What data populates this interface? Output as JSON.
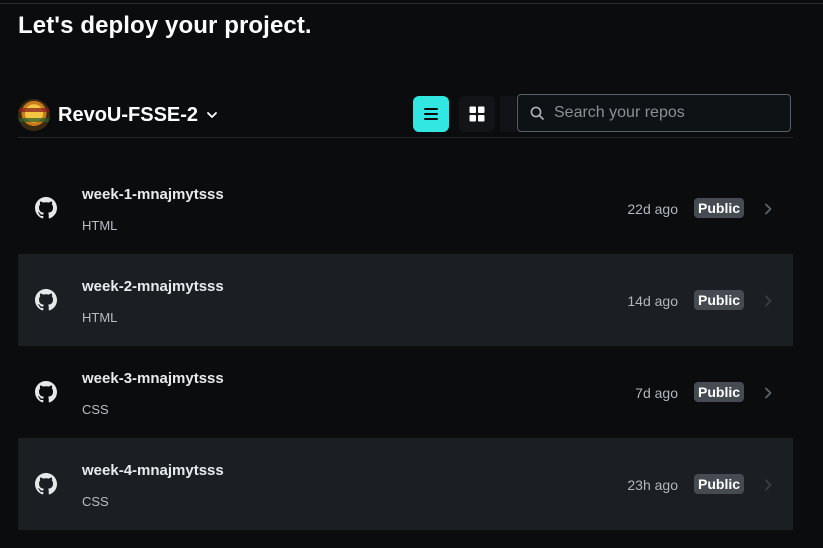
{
  "page": {
    "title": "Let's deploy your project."
  },
  "account": {
    "name": "RevoU-FSSE-2"
  },
  "view_toggle": {
    "selected": "list",
    "options": [
      "list",
      "grid"
    ]
  },
  "search": {
    "placeholder": "Search your repos",
    "value": ""
  },
  "repos": [
    {
      "name": "week-1-mnajmytsss",
      "language": "HTML",
      "updated": "22d ago",
      "visibility": "Public"
    },
    {
      "name": "week-2-mnajmytsss",
      "language": "HTML",
      "updated": "14d ago",
      "visibility": "Public"
    },
    {
      "name": "week-3-mnajmytsss",
      "language": "CSS",
      "updated": "7d ago",
      "visibility": "Public"
    },
    {
      "name": "week-4-mnajmytsss",
      "language": "CSS",
      "updated": "23h ago",
      "visibility": "Public"
    }
  ],
  "icons": {
    "repo": "github-icon",
    "search": "search-icon",
    "caret": "chevron-down-icon",
    "row_arrow": "chevron-right-icon",
    "list_view": "list-icon",
    "grid_view": "grid-icon"
  },
  "colors": {
    "background": "#0a0c0e",
    "accent": "#32e6e2",
    "row_alt": "#1b1f24",
    "badge": "#464b52"
  }
}
